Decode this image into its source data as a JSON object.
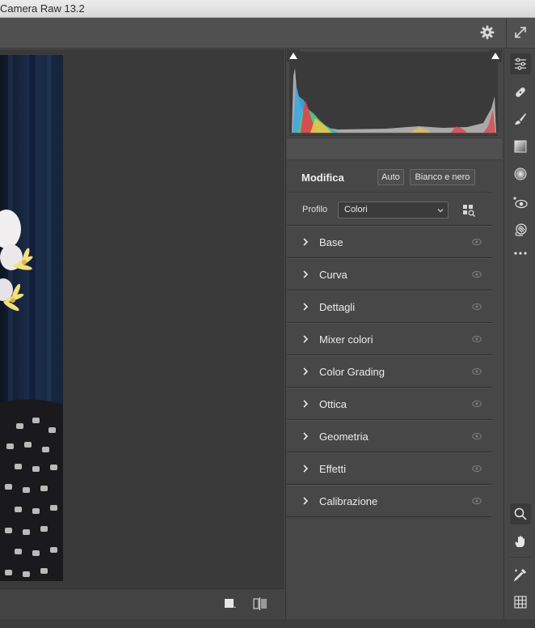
{
  "window": {
    "title": "Camera Raw 13.2"
  },
  "edit": {
    "title": "Modifica",
    "auto_label": "Auto",
    "bw_label": "Bianco e nero",
    "profile_label": "Profilo",
    "profile_value": "Colori"
  },
  "sections": [
    {
      "label": "Base"
    },
    {
      "label": "Curva"
    },
    {
      "label": "Dettagli"
    },
    {
      "label": "Mixer colori"
    },
    {
      "label": "Color Grading"
    },
    {
      "label": "Ottica"
    },
    {
      "label": "Geometria"
    },
    {
      "label": "Effetti"
    },
    {
      "label": "Calibrazione"
    }
  ],
  "icons": {
    "top": [
      "gear-icon",
      "fullscreen-icon"
    ],
    "rail": [
      "edit-sliders-icon",
      "healing-icon",
      "brush-icon",
      "gradient-icon",
      "radial-filter-icon",
      "redeye-icon",
      "presets-icon",
      "more-icon",
      "zoom-icon",
      "hand-icon",
      "color-sampler-icon",
      "grid-icon"
    ],
    "bottom": [
      "view-mode-icon",
      "before-after-icon"
    ]
  },
  "colors": {
    "panel": "#474747",
    "canvas": "#3a3a3a",
    "accent": "#ececec"
  }
}
